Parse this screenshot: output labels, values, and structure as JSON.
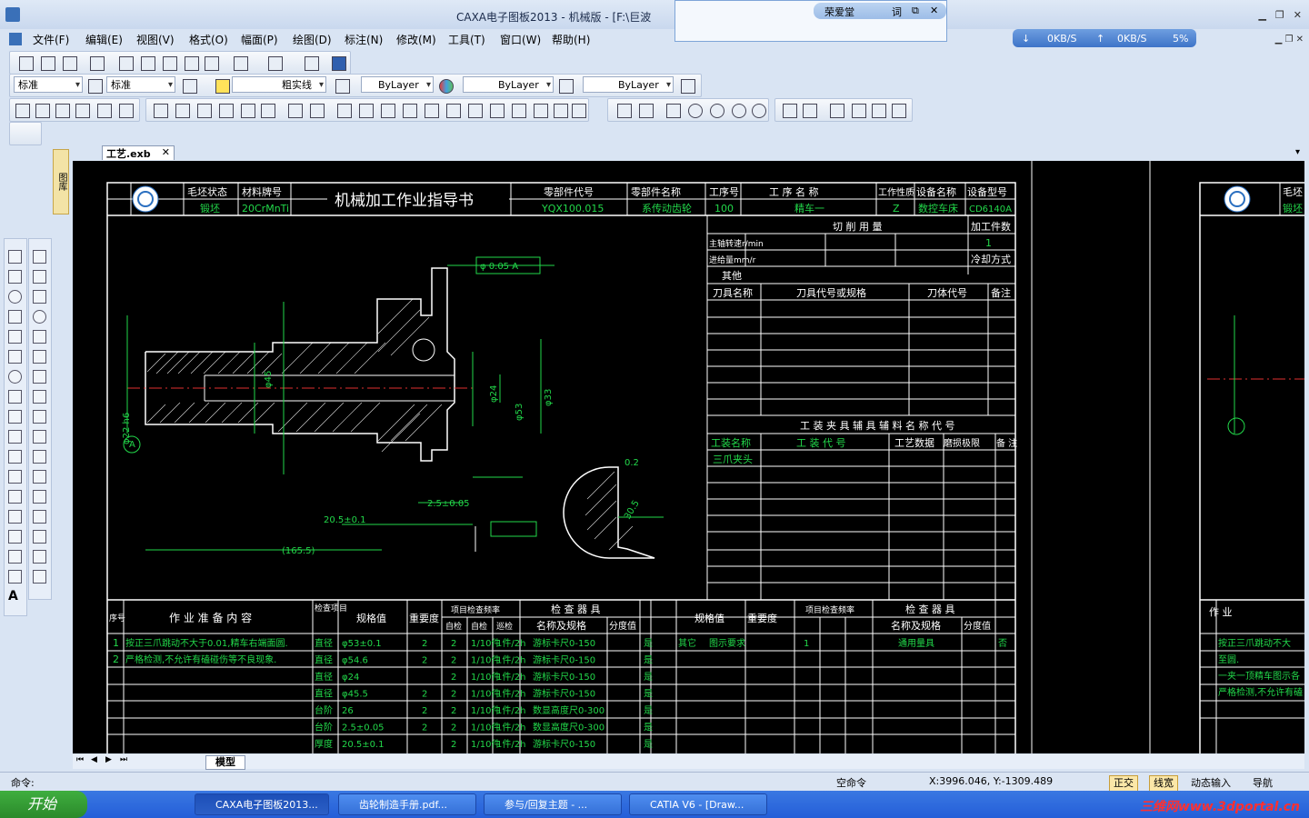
{
  "window": {
    "title": "CAXA电子图板2013 - 机械版 - [F:\\巨波"
  },
  "dict_popup": {
    "name": "荣爱堂",
    "btn1": "词",
    "btn2": "⧉",
    "close": "✕"
  },
  "netspeed": {
    "down": "0KB/S",
    "up": "0KB/S",
    "percent": "5%"
  },
  "menu": [
    "文件(F)",
    "编辑(E)",
    "视图(V)",
    "格式(O)",
    "幅面(P)",
    "绘图(D)",
    "标注(N)",
    "修改(M)",
    "工具(T)",
    "窗口(W)",
    "帮助(H)"
  ],
  "props": {
    "style1": "标准",
    "style2": "标准",
    "layer": "粗实线",
    "color": "ByLayer",
    "linetype": "ByLayer",
    "linewidth": "ByLayer"
  },
  "side_tab": "图库",
  "sheet_tab": "工艺.exb",
  "model_tab": "模型",
  "drawing": {
    "h_blank": "毛坯状态",
    "v_blank": "锻坯",
    "h_mat": "材料牌号",
    "v_mat": "20CrMnTi",
    "title": "机械加工作业指导书",
    "h_partno": "零部件代号",
    "v_partno": "YQX100.015",
    "h_partname": "零部件名称",
    "v_partname": "系传动齿轮",
    "h_procno": "工序号",
    "v_procno": "100",
    "h_procname": "工 序 名 称",
    "v_procname": "精车一",
    "h_nature": "工作性质",
    "v_nature": "Z",
    "h_equip": "设备名称",
    "v_equip": "数控车床",
    "h_model": "设备型号",
    "v_model": "CD6140A",
    "cut_param": "切 削 用 量",
    "work_count": "加工件数",
    "work_count_v": "1",
    "spindle": "主轴转速r/min",
    "feed": "进给量mm/r",
    "cooling": "冷却方式",
    "other": "其他",
    "tool_name": "刀具名称",
    "tool_code": "刀具代号或规格",
    "holder_code": "刀体代号",
    "note": "备注",
    "fixture_title": "工 装 夹 具 辅 具 辅 料 名 称 代 号",
    "fix_name": "工装名称",
    "fix_code": "工 装 代 号",
    "fix_data": "工艺数据",
    "fix_limit": "磨损极限",
    "fix_note": "备 注",
    "fix_v": "三爪夹头",
    "dims": [
      "φ 0.05 A",
      "φ22 h6",
      "φ45",
      "φ33",
      "φ24",
      "φ53",
      "20.5±0.1",
      "(165.5)",
      "2.5±0.05",
      "A",
      "0.2",
      "30.5"
    ],
    "inspect": {
      "hdr_seq": "序号",
      "hdr_content": "作 业 准 备 内 容",
      "hdr_item": "检查项目",
      "hdr_spec": "规格值",
      "hdr_level": "重要度",
      "hdr_freq": "项目检查频率",
      "hdr_self": "自检",
      "hdr_mutual": "自检",
      "hdr_patrol": "巡检",
      "hdr_tool": "检 查 器 具",
      "hdr_toolname": "名称及规格",
      "hdr_res": "分度值",
      "hdr_rec": "记录",
      "content": [
        "按正三爪跳动不大于0.01,精车右端面圆.",
        "严格检测,不允许有磕碰伤等不良现象."
      ],
      "left_rows": [
        [
          "直径",
          "φ53±0.1",
          "2",
          "2",
          "1/10件",
          "1件/2h",
          "游标卡尺0-150",
          "是"
        ],
        [
          "直径",
          "φ54.6",
          "2",
          "2",
          "1/10件",
          "1件/2h",
          "游标卡尺0-150",
          "是"
        ],
        [
          "直径",
          "φ24",
          "",
          "2",
          "1/10件",
          "1件/2h",
          "游标卡尺0-150",
          "是"
        ],
        [
          "直径",
          "φ45.5",
          "2",
          "2",
          "1/10件",
          "1件/2h",
          "游标卡尺0-150",
          "是"
        ],
        [
          "台阶",
          "26",
          "2",
          "2",
          "1/10件",
          "1件/2h",
          "数显高度尺0-300",
          "是"
        ],
        [
          "台阶",
          "2.5±0.05",
          "2",
          "2",
          "1/10件",
          "1件/2h",
          "数显高度尺0-300",
          "是"
        ],
        [
          "厚度",
          "20.5±0.1",
          "",
          "2",
          "1/10件",
          "1件/2h",
          "游标卡尺0-150",
          "是"
        ]
      ],
      "right_row": [
        "其它",
        "图示要求",
        "1",
        "通用量具",
        "否"
      ]
    },
    "right_sheet": {
      "hdr1": "毛坯",
      "cell1": "锻坯",
      "content_hdr": "作 业",
      "row1": "按正三爪跳动不大",
      "row1b": "至圆.",
      "row2": "一夹一顶精车图示各",
      "row3": "严格检测,不允许有磕"
    }
  },
  "status": {
    "prompt": "命令:",
    "mode": "空命令",
    "coords": "X:3996.046, Y:-1309.489",
    "ortho": "正交",
    "lw": "线宽",
    "dyn": "动态输入",
    "nav": "导航"
  },
  "taskbar": {
    "start": "开始",
    "tasks": [
      "CAXA电子图板2013...",
      "齿轮制造手册.pdf...",
      "参与/回复主题 - ...",
      "CATIA V6 - [Draw..."
    ],
    "watermark": "三维网www.3dportal.cn"
  },
  "colors": {
    "canvas": "#000000",
    "line": "#ffffff",
    "green": "#22d84a",
    "red": "#e03030",
    "accent": "#3a70b8"
  }
}
